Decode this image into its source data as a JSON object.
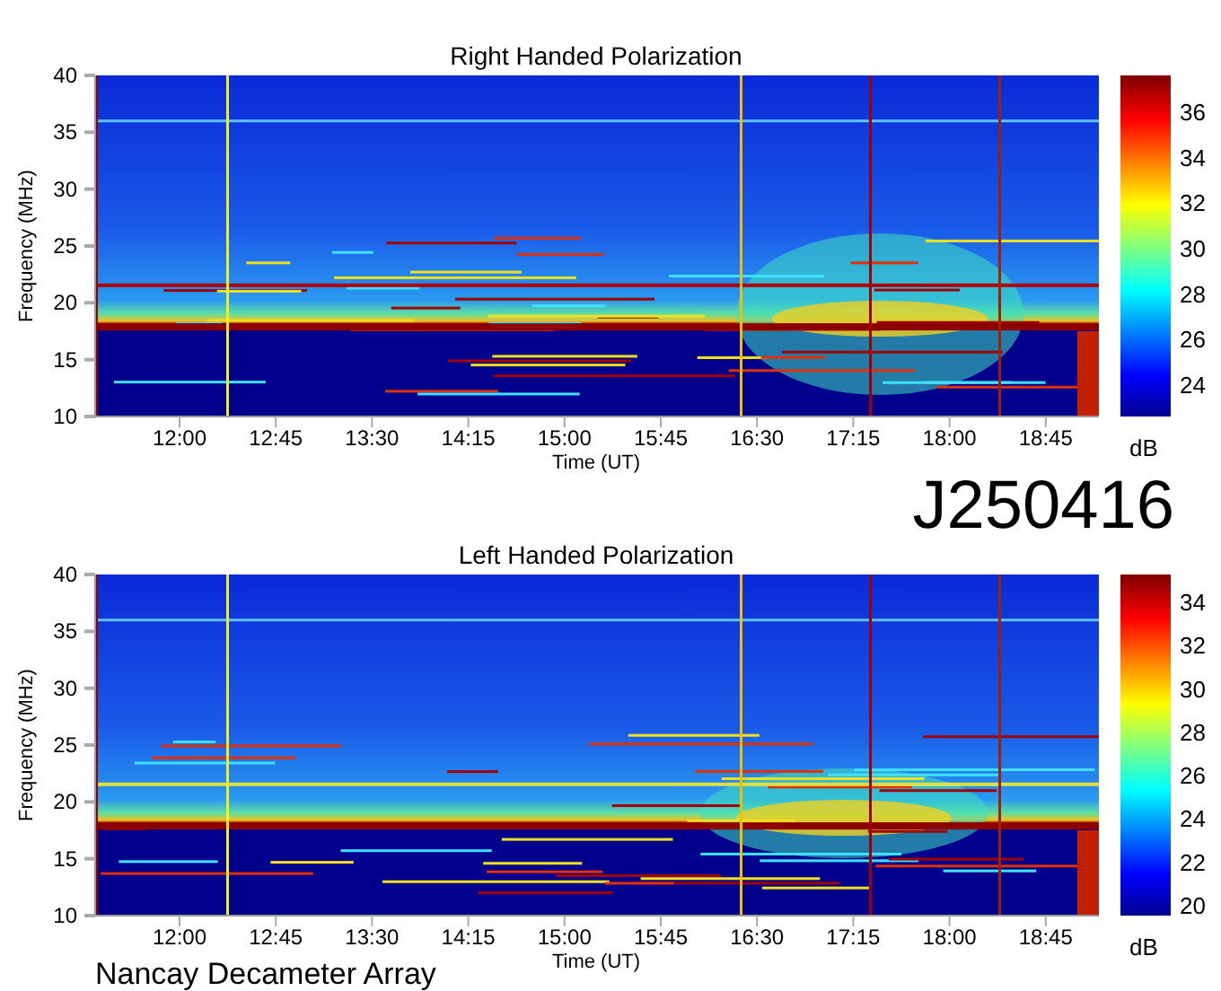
{
  "panels": [
    {
      "title": "Right Handed Polarization",
      "ylabel": "Frequency (MHz)",
      "xlabel": "Time (UT)",
      "yticks": [
        "40",
        "35",
        "30",
        "25",
        "20",
        "15",
        "10"
      ],
      "xticks": [
        "12:00",
        "12:45",
        "13:30",
        "14:15",
        "15:00",
        "15:45",
        "16:30",
        "17:15",
        "18:00",
        "18:45"
      ],
      "colorbar": {
        "unit": "dB",
        "ticks": [
          "36",
          "34",
          "32",
          "30",
          "28",
          "26",
          "24"
        ]
      }
    },
    {
      "title": "Left Handed Polarization",
      "ylabel": "Frequency (MHz)",
      "xlabel": "Time (UT)",
      "yticks": [
        "40",
        "35",
        "30",
        "25",
        "20",
        "15",
        "10"
      ],
      "xticks": [
        "12:00",
        "12:45",
        "13:30",
        "14:15",
        "15:00",
        "15:45",
        "16:30",
        "17:15",
        "18:00",
        "18:45"
      ],
      "colorbar": {
        "unit": "dB",
        "ticks": [
          "34",
          "32",
          "30",
          "28",
          "26",
          "24",
          "22",
          "20"
        ]
      },
      "footer": "Nancay Decameter Array"
    }
  ],
  "date_label": "J250416"
}
